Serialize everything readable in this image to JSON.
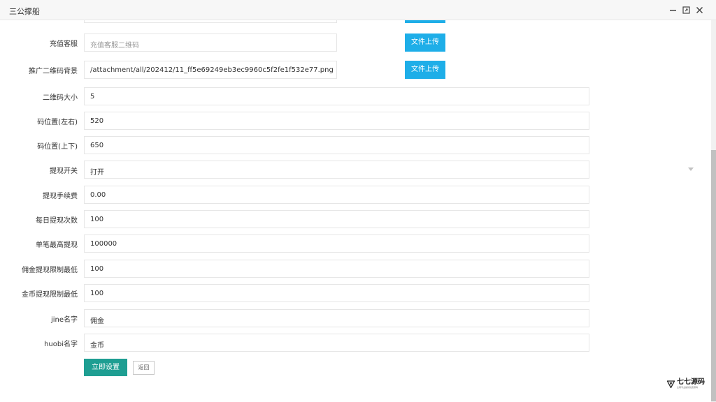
{
  "window": {
    "title": "三公撑船"
  },
  "form": {
    "rows": [
      {
        "label": "充值客服",
        "value": "",
        "placeholder": "充值客服二维码",
        "button": "文件上传"
      },
      {
        "label": "推广二维码背景",
        "value": "/attachment/all/202412/11_ff5e69249eb3ec9960c5f2fe1f532e77.png",
        "button": "文件上传"
      },
      {
        "label": "二维码大小",
        "value": "5"
      },
      {
        "label": "码位置(左右)",
        "value": "520"
      },
      {
        "label": "码位置(上下)",
        "value": "650"
      },
      {
        "label": "提现开关",
        "value": "打开"
      },
      {
        "label": "提现手续费",
        "value": "0.00"
      },
      {
        "label": "每日提现次数",
        "value": "100"
      },
      {
        "label": "单笔最高提现",
        "value": "100000"
      },
      {
        "label": "佣金提现限制最低",
        "value": "100"
      },
      {
        "label": "金币提现限制最低",
        "value": "100"
      },
      {
        "label": "jine名字",
        "value": "佣金"
      },
      {
        "label": "huobi名字",
        "value": "金币"
      }
    ],
    "submit_label": "立即设置",
    "back_label": "返回"
  },
  "watermark": {
    "name": "七七源码",
    "tagline": "全网专业提供优质源码"
  }
}
